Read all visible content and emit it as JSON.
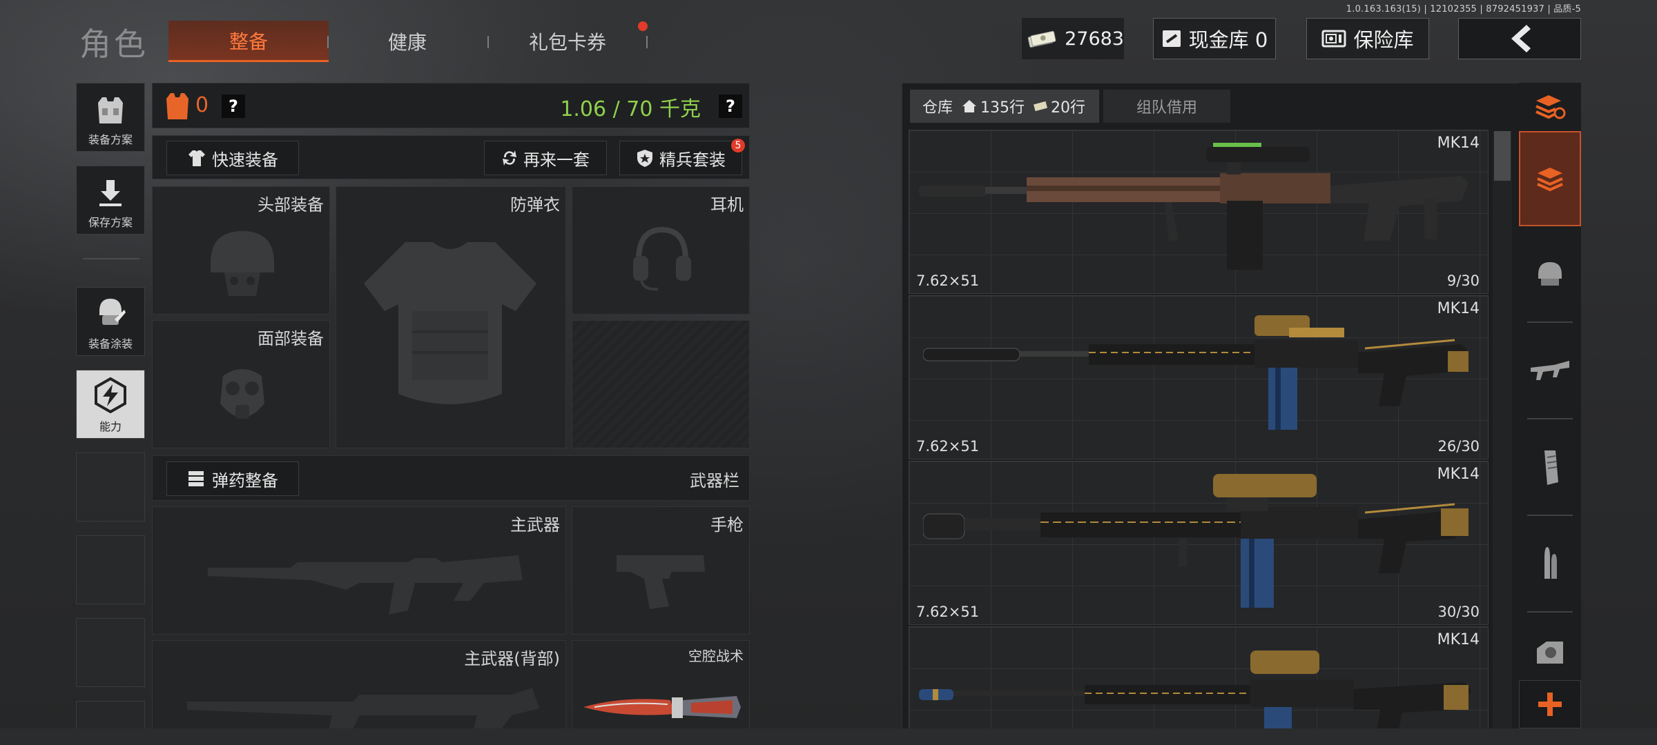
{
  "version": "1.0.163.163(15) | 12102355 | 8792451937 | 品质-5",
  "header": {
    "title": "角色",
    "tabs": [
      {
        "label": "整备",
        "active": true
      },
      {
        "label": "健康",
        "active": false
      },
      {
        "label": "礼包卡券",
        "active": false,
        "notification": true
      }
    ],
    "currency_value": "27683",
    "cash_vault_label": "现金库 0",
    "safe_label": "保险库"
  },
  "sidebar": {
    "items": [
      {
        "label": "装备方案",
        "icon": "vest-icon"
      },
      {
        "label": "保存方案",
        "icon": "download-icon"
      },
      {
        "label": "装备涂装",
        "icon": "helmet-paint-icon"
      },
      {
        "label": "能力",
        "icon": "lightning-icon",
        "active": true
      }
    ]
  },
  "loadout": {
    "armor_count": "0",
    "weight": "1.06 / 70 千克",
    "quick_equip": "快速装备",
    "again": "再来一套",
    "elite": "精兵套装",
    "elite_badge": "5",
    "slots": {
      "head": "头部装备",
      "vest": "防弹衣",
      "headset": "耳机",
      "face": "面部装备"
    },
    "ammo_button": "弹药整备",
    "weapon_bar": "武器栏",
    "weapon_slots": {
      "primary": "主武器",
      "pistol": "手枪",
      "primary_back": "主武器(背部)",
      "melee": "空腔战术"
    }
  },
  "storage": {
    "tab_label": "仓库",
    "rows_a": "135行",
    "rows_b": "20行",
    "team_borrow": "组队借用",
    "items": [
      {
        "name": "MK14",
        "caliber": "7.62×51",
        "count": "9/30",
        "variant": "rust"
      },
      {
        "name": "MK14",
        "caliber": "7.62×51",
        "count": "26/30",
        "variant": "gold"
      },
      {
        "name": "MK14",
        "caliber": "7.62×51",
        "count": "30/30",
        "variant": "gold"
      },
      {
        "name": "MK14",
        "caliber": "",
        "count": "",
        "variant": "gold"
      }
    ]
  },
  "colors": {
    "accent": "#e86224",
    "weight_green": "#8fd14f",
    "badge_red": "#e23b2b"
  }
}
